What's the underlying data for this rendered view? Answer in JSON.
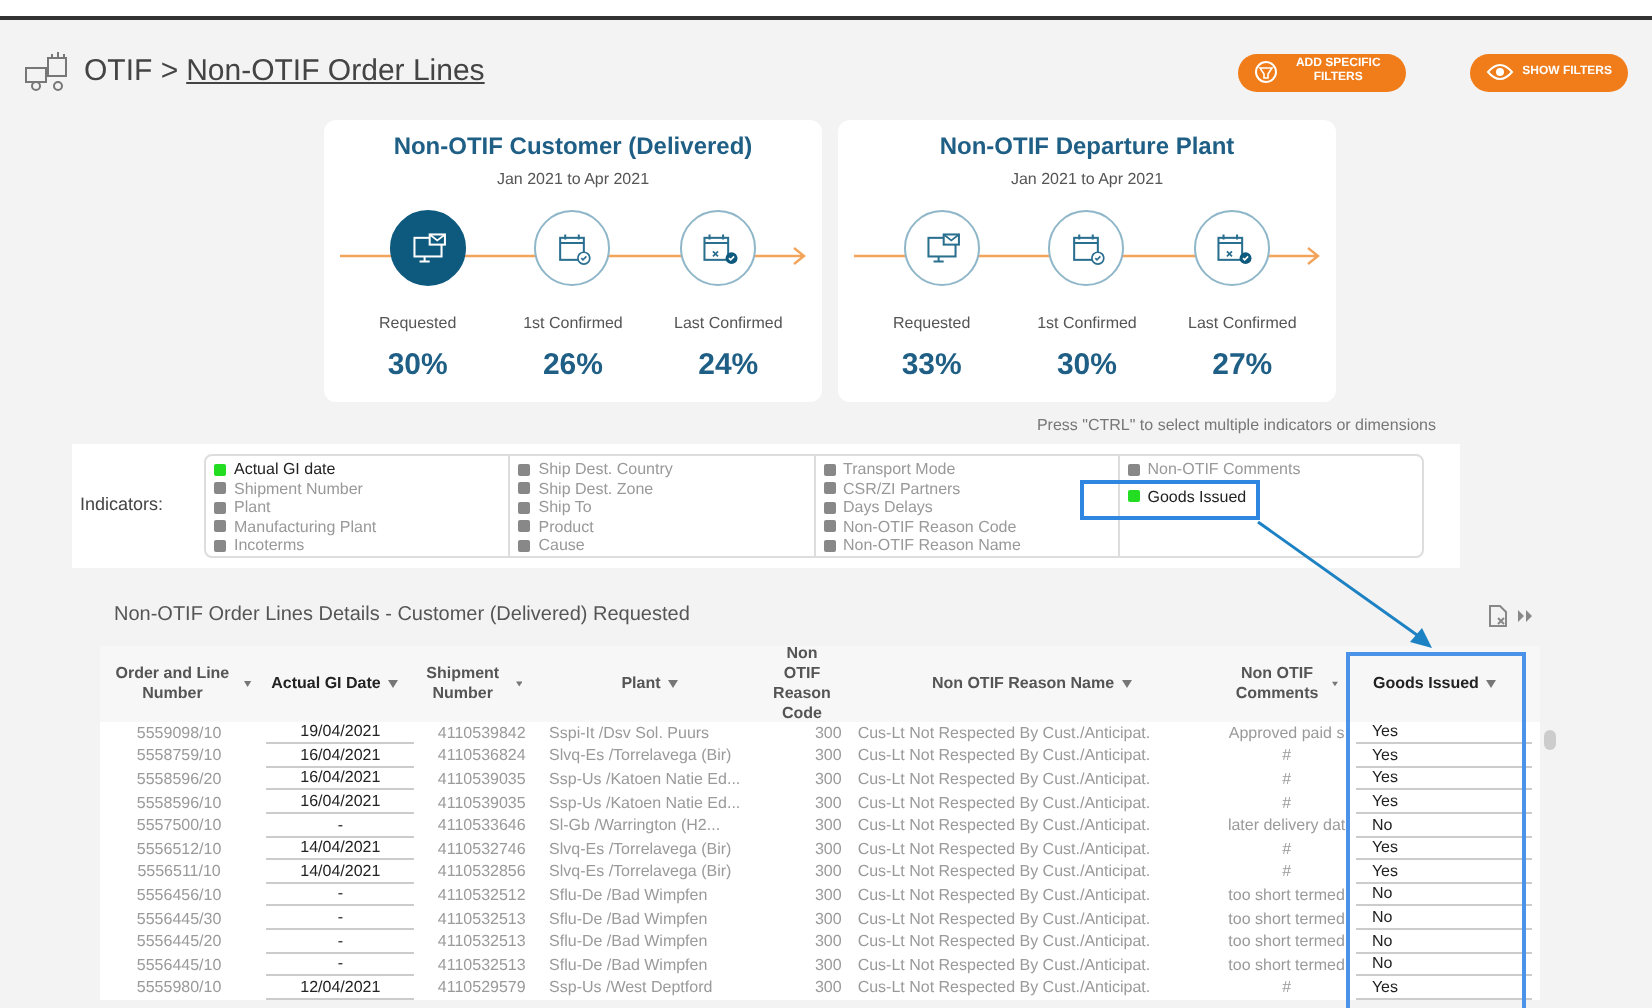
{
  "header": {
    "section": "OTIF >",
    "page_link": "Non-OTIF Order Lines"
  },
  "buttons": [
    {
      "label": "ADD SPECIFIC FILTERS",
      "kind": "filter"
    },
    {
      "label": "SHOW FILTERS",
      "kind": "eye"
    }
  ],
  "cards": [
    {
      "title": "Non-OTIF Customer (Delivered)",
      "period": "Jan 2021 to Apr 2021",
      "steps": [
        {
          "kind": "monitor",
          "label": "Requested",
          "value": "30%",
          "selected": true
        },
        {
          "kind": "calendar-check",
          "label": "1st Confirmed",
          "value": "26%",
          "selected": false
        },
        {
          "kind": "calendar-cross",
          "label": "Last Confirmed",
          "value": "24%",
          "selected": false
        }
      ]
    },
    {
      "title": "Non-OTIF Departure Plant",
      "period": "Jan 2021 to Apr 2021",
      "steps": [
        {
          "kind": "monitor",
          "label": "Requested",
          "value": "33%",
          "selected": false
        },
        {
          "kind": "calendar-check",
          "label": "1st Confirmed",
          "value": "30%",
          "selected": false
        },
        {
          "kind": "calendar-cross",
          "label": "Last Confirmed",
          "value": "27%",
          "selected": false
        }
      ]
    }
  ],
  "hint": "Press \"CTRL\" to select multiple indicators or dimensions",
  "indicators": {
    "label": "Indicators:",
    "columns": [
      [
        {
          "label": "Actual GI date",
          "selected": true
        },
        {
          "label": "Shipment Number",
          "selected": false
        },
        {
          "label": "Plant",
          "selected": false
        },
        {
          "label": "Manufacturing Plant",
          "selected": false
        },
        {
          "label": "Incoterms",
          "selected": false
        }
      ],
      [
        {
          "label": "Ship Dest. Country",
          "selected": false
        },
        {
          "label": "Ship Dest. Zone",
          "selected": false
        },
        {
          "label": "Ship To",
          "selected": false
        },
        {
          "label": "Product",
          "selected": false
        },
        {
          "label": "Cause",
          "selected": false
        }
      ],
      [
        {
          "label": "Transport Mode",
          "selected": false
        },
        {
          "label": "CSR/ZI Partners",
          "selected": false
        },
        {
          "label": "Days Delays",
          "selected": false
        },
        {
          "label": "Non-OTIF Reason Code",
          "selected": false
        },
        {
          "label": "Non-OTIF Reason Name",
          "selected": false
        }
      ],
      [
        {
          "label": "Non-OTIF Comments",
          "selected": false
        },
        {
          "label": "Goods Issued",
          "selected": true
        }
      ]
    ]
  },
  "table": {
    "title": "Non-OTIF Order Lines Details - Customer (Delivered) Requested",
    "columns": [
      {
        "label": "Order and Line Number",
        "highlighted": false
      },
      {
        "label": "Actual GI Date",
        "highlighted": true
      },
      {
        "label": "Shipment Number",
        "highlighted": false
      },
      {
        "label": "Plant",
        "highlighted": false
      },
      {
        "label": "Non OTIF Reason Code",
        "highlighted": false
      },
      {
        "label": "Non OTIF Reason Name",
        "highlighted": false
      },
      {
        "label": "Non OTIF Comments",
        "highlighted": false
      },
      {
        "label": "Goods Issued",
        "highlighted": true
      }
    ],
    "rows": [
      [
        "5559098/10",
        "19/04/2021",
        "4110539842",
        "Sspi-It /Dsv Sol. Puurs",
        "300",
        "Cus-Lt Not Respected By Cust./Anticipat.",
        "Approved paid s",
        "Yes"
      ],
      [
        "5558759/10",
        "16/04/2021",
        "4110536824",
        "Slvq-Es /Torrelavega (Bir)",
        "300",
        "Cus-Lt Not Respected By Cust./Anticipat.",
        "#",
        "Yes"
      ],
      [
        "5558596/20",
        "16/04/2021",
        "4110539035",
        "Ssp-Us /Katoen Natie Ed...",
        "300",
        "Cus-Lt Not Respected By Cust./Anticipat.",
        "#",
        "Yes"
      ],
      [
        "5558596/10",
        "16/04/2021",
        "4110539035",
        "Ssp-Us /Katoen Natie Ed...",
        "300",
        "Cus-Lt Not Respected By Cust./Anticipat.",
        "#",
        "Yes"
      ],
      [
        "5557500/10",
        "-",
        "4110533646",
        "Sl-Gb /Warrington (H2...",
        "300",
        "Cus-Lt Not Respected By Cust./Anticipat.",
        "later delivery dat",
        "No"
      ],
      [
        "5556512/10",
        "14/04/2021",
        "4110532746",
        "Slvq-Es /Torrelavega (Bir)",
        "300",
        "Cus-Lt Not Respected By Cust./Anticipat.",
        "#",
        "Yes"
      ],
      [
        "5556511/10",
        "14/04/2021",
        "4110532856",
        "Slvq-Es /Torrelavega (Bir)",
        "300",
        "Cus-Lt Not Respected By Cust./Anticipat.",
        "#",
        "Yes"
      ],
      [
        "5556456/10",
        "-",
        "4110532512",
        "Sflu-De /Bad Wimpfen",
        "300",
        "Cus-Lt Not Respected By Cust./Anticipat.",
        "too short termed",
        "No"
      ],
      [
        "5556445/30",
        "-",
        "4110532513",
        "Sflu-De /Bad Wimpfen",
        "300",
        "Cus-Lt Not Respected By Cust./Anticipat.",
        "too short termed",
        "No"
      ],
      [
        "5556445/20",
        "-",
        "4110532513",
        "Sflu-De /Bad Wimpfen",
        "300",
        "Cus-Lt Not Respected By Cust./Anticipat.",
        "too short termed",
        "No"
      ],
      [
        "5556445/10",
        "-",
        "4110532513",
        "Sflu-De /Bad Wimpfen",
        "300",
        "Cus-Lt Not Respected By Cust./Anticipat.",
        "too short termed",
        "No"
      ],
      [
        "5555980/10",
        "12/04/2021",
        "4110529579",
        "Ssp-Us /West Deptford",
        "300",
        "Cus-Lt Not Respected By Cust./Anticipat.",
        "#",
        "Yes"
      ]
    ]
  }
}
